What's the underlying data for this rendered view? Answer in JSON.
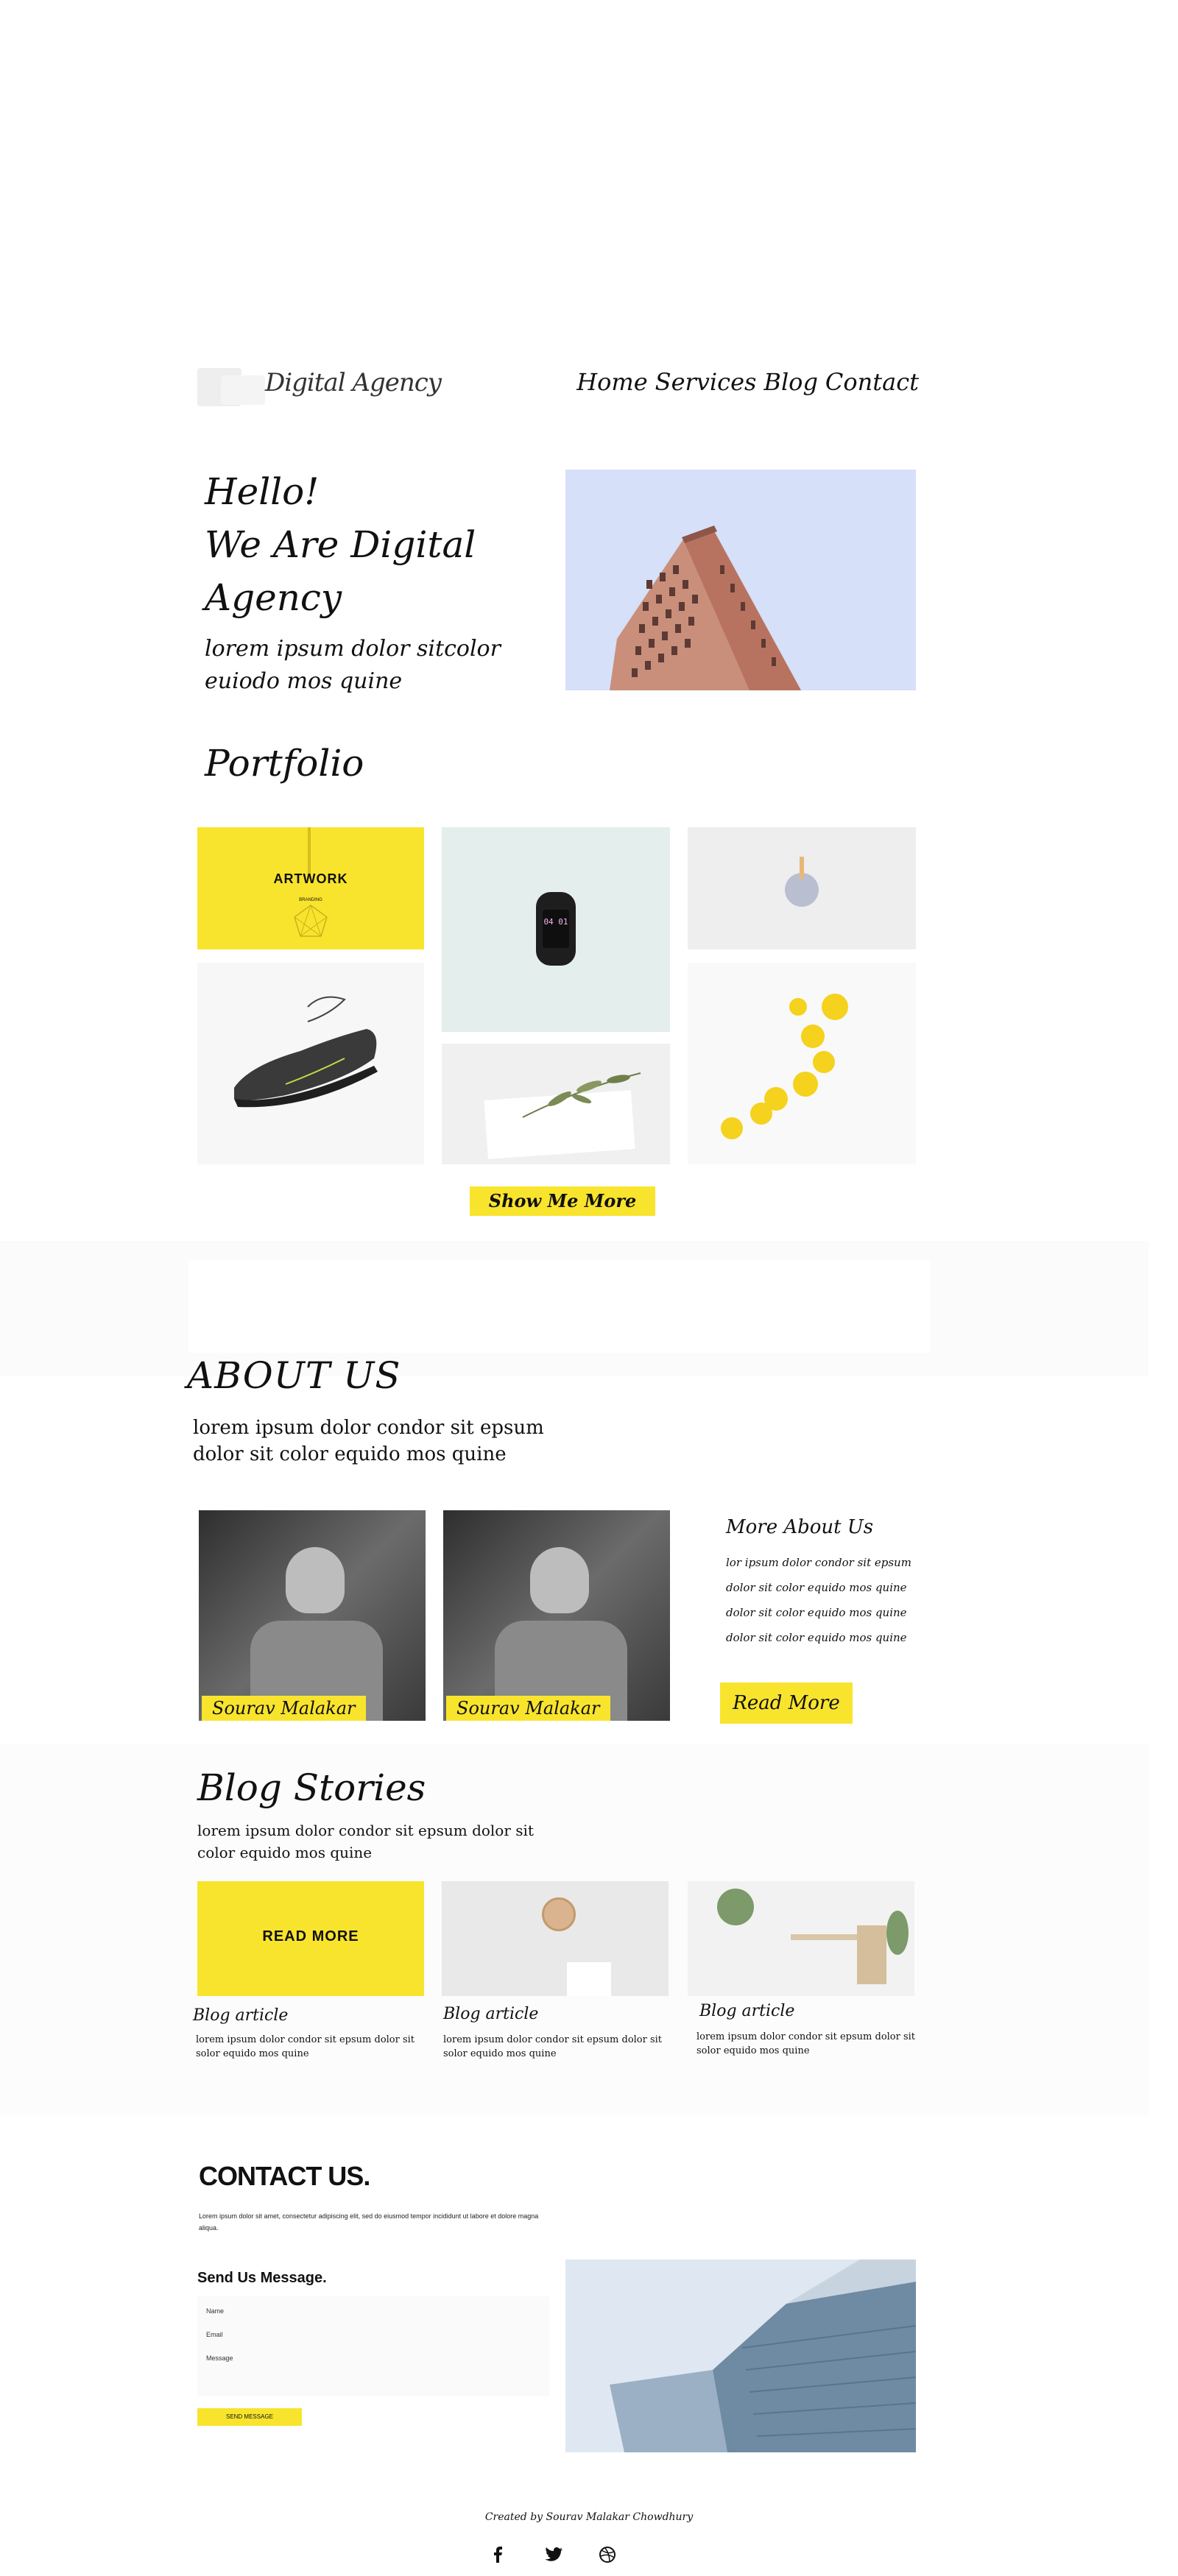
{
  "header": {
    "logo_text": "Digital Agency",
    "nav": [
      "Home",
      "Services",
      "Blog",
      "Contact"
    ]
  },
  "hero": {
    "title_lines": [
      "Hello!",
      "We Are Digital",
      "Agency"
    ],
    "subtitle": "lorem ipsum dolor sitcolor euiodo mos quine"
  },
  "portfolio": {
    "title": "Portfolio",
    "artwork_label": "ARTWORK",
    "artwork_sublabel": "BRANDING",
    "watch_display": "04 01",
    "show_more": "Show Me More"
  },
  "about": {
    "title": "ABOUT US",
    "subtitle": "lorem ipsum dolor condor sit epsum dolor sit color equido mos quine",
    "people": [
      "Sourav Malakar",
      "Sourav Malakar"
    ],
    "more_title": "More About Us",
    "more_lines": [
      "lor ipsum dolor condor sit epsum",
      "dolor sit color equido mos quine",
      "dolor sit color equido mos quine",
      "dolor sit color equido mos quine"
    ],
    "read_more": "Read More"
  },
  "blog": {
    "title": "Blog Stories",
    "subtitle": "lorem ipsum dolor condor sit epsum dolor sit color equido mos quine",
    "card_overlay": "READ MORE",
    "articles": [
      {
        "title": "Blog article",
        "text": "lorem ipsum dolor condor sit epsum dolor sit solor equido mos quine"
      },
      {
        "title": "Blog article",
        "text": "lorem ipsum dolor condor sit epsum dolor sit solor equido mos quine"
      },
      {
        "title": "Blog article",
        "text": "lorem ipsum dolor condor sit epsum dolor sit solor equido mos quine"
      }
    ]
  },
  "contact": {
    "title": "CONTACT US.",
    "text": "Lorem ipsum dolor sit amet, consectetur adipiscing elit, sed do eiusmod tempor incididunt ut labore et dolore magna aliqua.",
    "form_title": "Send Us Message.",
    "name_placeholder": "Name",
    "email_placeholder": "Email",
    "message_placeholder": "Message",
    "send_label": "SEND MESSAGE"
  },
  "footer": {
    "credit": "Created by Sourav Malakar Chowdhury",
    "social_icons": [
      "facebook-icon",
      "twitter-icon",
      "dribbble-icon"
    ]
  },
  "colors": {
    "accent": "#f9e42d",
    "hero_sky": "#d6e0f9"
  }
}
